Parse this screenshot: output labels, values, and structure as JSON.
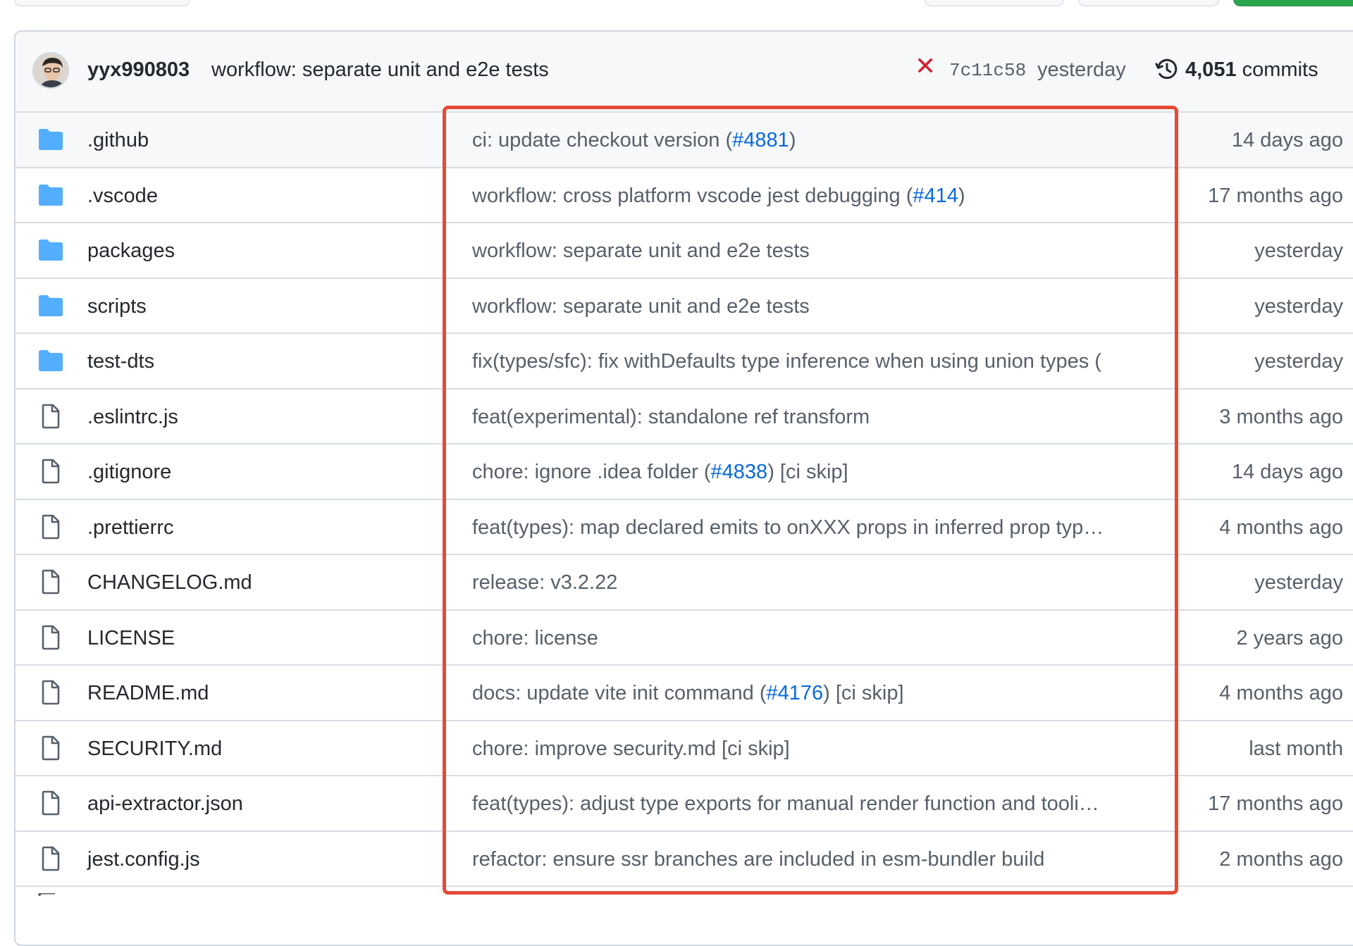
{
  "commit": {
    "author": "yyx990803",
    "message": "workflow: separate unit and e2e tests",
    "status_icon": "x-icon",
    "sha": "7c11c58",
    "time": "yesterday",
    "count": "4,051",
    "count_label": "commits"
  },
  "files": [
    {
      "type": "folder",
      "name": ".github",
      "msg_pre": "ci: update checkout version (",
      "msg_link": "#4881",
      "msg_post": ")",
      "age": "14 days ago"
    },
    {
      "type": "folder",
      "name": ".vscode",
      "msg_pre": "workflow: cross platform vscode jest debugging (",
      "msg_link": "#414",
      "msg_post": ")",
      "age": "17 months ago"
    },
    {
      "type": "folder",
      "name": "packages",
      "msg_pre": "workflow: separate unit and e2e tests",
      "msg_link": "",
      "msg_post": "",
      "age": "yesterday"
    },
    {
      "type": "folder",
      "name": "scripts",
      "msg_pre": "workflow: separate unit and e2e tests",
      "msg_link": "",
      "msg_post": "",
      "age": "yesterday"
    },
    {
      "type": "folder",
      "name": "test-dts",
      "msg_pre": "fix(types/sfc): fix withDefaults type inference when using union types (",
      "msg_link": "",
      "msg_post": "",
      "age": "yesterday"
    },
    {
      "type": "file",
      "name": ".eslintrc.js",
      "msg_pre": "feat(experimental): standalone ref transform",
      "msg_link": "",
      "msg_post": "",
      "age": "3 months ago"
    },
    {
      "type": "file",
      "name": ".gitignore",
      "msg_pre": "chore: ignore .idea folder (",
      "msg_link": "#4838",
      "msg_post": ") [ci skip]",
      "age": "14 days ago"
    },
    {
      "type": "file",
      "name": ".prettierrc",
      "msg_pre": "feat(types): map declared emits to onXXX props in inferred prop typ…",
      "msg_link": "",
      "msg_post": "",
      "age": "4 months ago"
    },
    {
      "type": "file",
      "name": "CHANGELOG.md",
      "msg_pre": "release: v3.2.22",
      "msg_link": "",
      "msg_post": "",
      "age": "yesterday"
    },
    {
      "type": "file",
      "name": "LICENSE",
      "msg_pre": "chore: license",
      "msg_link": "",
      "msg_post": "",
      "age": "2 years ago"
    },
    {
      "type": "file",
      "name": "README.md",
      "msg_pre": "docs: update vite init command (",
      "msg_link": "#4176",
      "msg_post": ") [ci skip]",
      "age": "4 months ago"
    },
    {
      "type": "file",
      "name": "SECURITY.md",
      "msg_pre": "chore: improve security.md [ci skip]",
      "msg_link": "",
      "msg_post": "",
      "age": "last month"
    },
    {
      "type": "file",
      "name": "api-extractor.json",
      "msg_pre": "feat(types): adjust type exports for manual render function and tooli…",
      "msg_link": "",
      "msg_post": "",
      "age": "17 months ago"
    },
    {
      "type": "file",
      "name": "jest.config.js",
      "msg_pre": "refactor: ensure ssr branches are included in esm-bundler build",
      "msg_link": "",
      "msg_post": "",
      "age": "2 months ago"
    }
  ],
  "colors": {
    "folder": "#54aeff",
    "link": "#0969da",
    "highlight": "#e54a36",
    "error": "#cf222e"
  }
}
